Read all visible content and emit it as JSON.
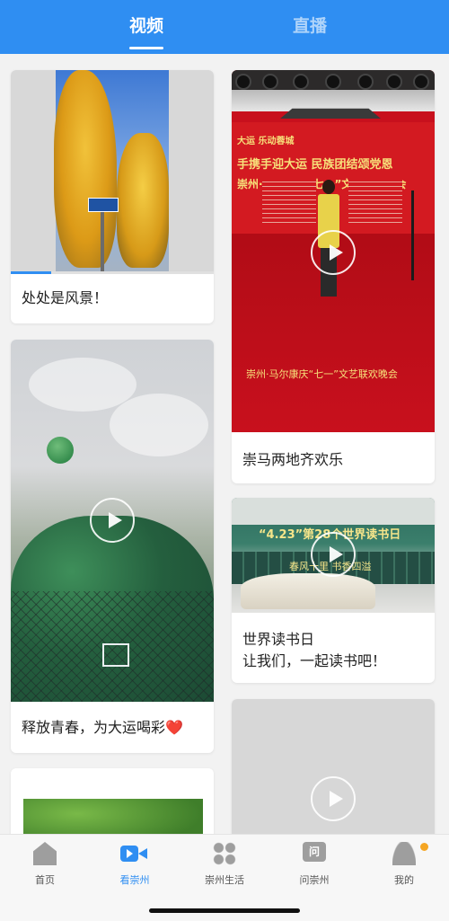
{
  "header": {
    "tabs": [
      {
        "label": "视频",
        "active": true
      },
      {
        "label": "直播",
        "active": false
      }
    ]
  },
  "colors": {
    "accent": "#2f8ef2",
    "notify_dot": "#f5a623"
  },
  "feed": {
    "cards": [
      {
        "caption": "处处是风景！",
        "progress": 0.2
      },
      {
        "caption": "崇马两地齐欢乐",
        "banner_lines": [
          "大运  乐动蓉城",
          "手携手迎大运  民族团结颂党恩",
          "崇州·马尔康庆“七一”文艺联欢晚会"
        ],
        "stage_text": "崇州·马尔康庆“七一”文艺联欢晚会"
      },
      {
        "caption": "释放青春，为大运喝彩",
        "emoji": "❤️"
      },
      {
        "caption": "世界读书日\n让我们，一起读书吧！",
        "image_text_1": "“4.23”第28个世界读书日",
        "image_text_2": "春风十里 书香四溢"
      },
      {
        "caption": ""
      },
      {
        "caption": ""
      }
    ]
  },
  "bottom_nav": {
    "items": [
      {
        "label": "首页",
        "icon": "home-icon"
      },
      {
        "label": "看崇州",
        "icon": "video-icon",
        "active": true
      },
      {
        "label": "崇州生活",
        "icon": "grid-icon"
      },
      {
        "label": "问崇州",
        "icon": "question-icon",
        "glyph": "问"
      },
      {
        "label": "我的",
        "icon": "user-icon"
      }
    ]
  }
}
